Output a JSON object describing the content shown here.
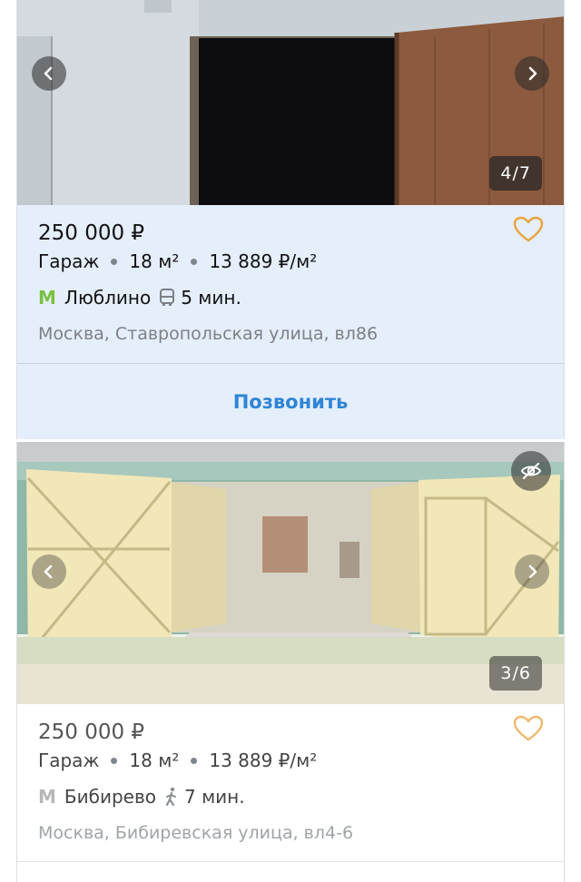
{
  "listings": [
    {
      "counter": "4/7",
      "price": "250 000 ₽",
      "type": "Гараж",
      "area": "18 м²",
      "price_per_m2": "13 889 ₽/м²",
      "metro": "Люблино",
      "metro_color": "#7ac142",
      "transport": "bus-icon",
      "time": "5 мин.",
      "address": "Москва, Ставропольская улица, вл86",
      "call_label": "Позвонить"
    },
    {
      "counter": "3/6",
      "price": "250 000 ₽",
      "type": "Гараж",
      "area": "18 м²",
      "price_per_m2": "13 889 ₽/м²",
      "metro": "Бибирево",
      "metro_color": "#b7b7b7",
      "transport": "walk-icon",
      "time": "7 мин.",
      "address": "Москва, Бибиревская улица, вл4-6"
    }
  ],
  "colors": {
    "accent": "#2f85d6",
    "favorite": "#e8a33d",
    "highlight_bg": "#e5eefb"
  }
}
